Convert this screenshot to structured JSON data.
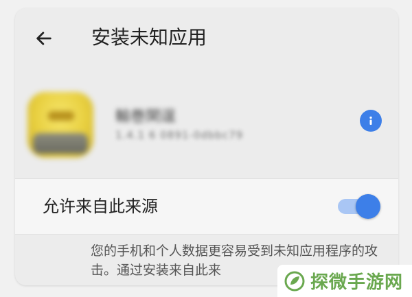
{
  "header": {
    "back_icon": "arrow-left-icon",
    "title": "安装未知应用"
  },
  "app": {
    "name": "輸巻閑逞",
    "version": "1.4.1 6 0891-0dbbc79",
    "info_icon": "info-icon"
  },
  "permission": {
    "label": "允许来自此来源",
    "enabled": true
  },
  "description": "您的手机和个人数据更容易受到未知应用程序的攻击。通过安装来自此来",
  "watermark": {
    "logo_icon": "leaf-logo-icon",
    "text": "探微手游网"
  },
  "colors": {
    "accent": "#3d7fe8",
    "accent_light": "#a9c6f4",
    "watermark_green": "#6aa84f"
  }
}
